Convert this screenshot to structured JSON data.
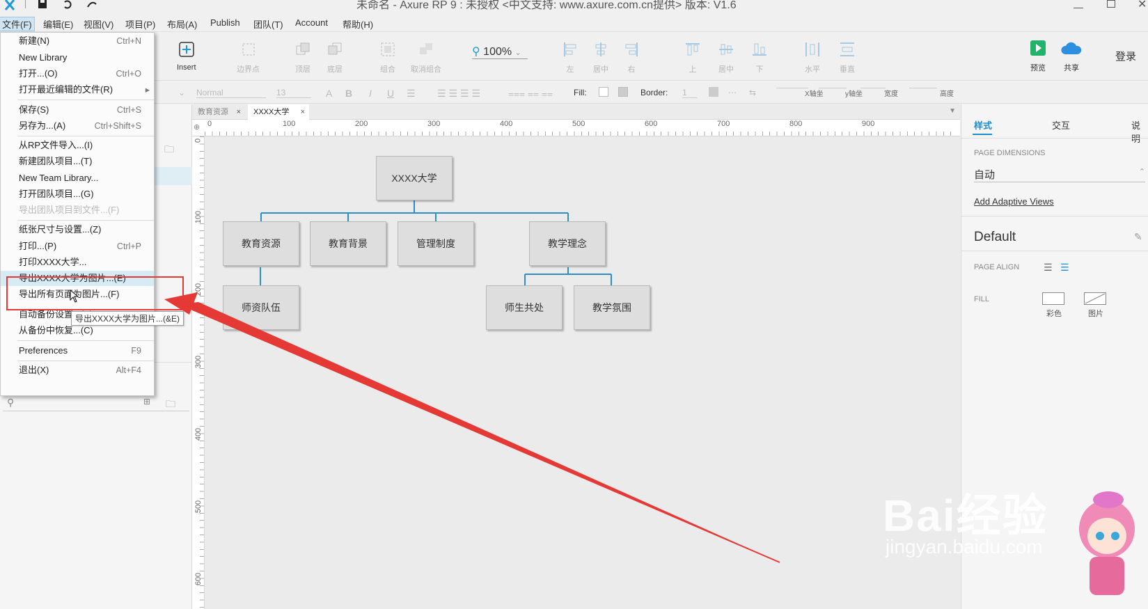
{
  "window": {
    "title": "未命名 - Axure RP 9 : 未授权   <中文支持: www.axure.com.cn提供> 版本: V1.6"
  },
  "menubar": [
    "文件(F)",
    "编辑(E)",
    "视图(V)",
    "项目(P)",
    "布局(A)",
    "Publish",
    "团队(T)",
    "Account",
    "帮助(H)"
  ],
  "toolbar": {
    "insert": "Insert",
    "boundary": "边界点",
    "top_layer": "顶层",
    "bottom_layer": "底层",
    "group": "组合",
    "ungroup": "取消组合",
    "zoom": "100%",
    "align_left": "左",
    "align_center": "居中",
    "align_right": "右",
    "align_top": "上",
    "align_middle": "居中",
    "align_bottom": "下",
    "dist_h": "水平",
    "dist_v": "垂直",
    "preview": "预览",
    "share": "共享",
    "login": "登录"
  },
  "formatbar": {
    "style": "Normal",
    "size": "13",
    "fill": "Fill:",
    "border": "Border:",
    "border_val": "1",
    "x": "X轴坐",
    "y": "y轴坐",
    "w": "宽度",
    "h": "高度"
  },
  "tabs": [
    "教育资源",
    "XXXX大学"
  ],
  "ruler_h": [
    "0",
    "100",
    "200",
    "300",
    "400",
    "500",
    "600",
    "700",
    "800",
    "900"
  ],
  "ruler_v": [
    "0",
    "100",
    "200",
    "300",
    "400",
    "500",
    "600"
  ],
  "diagram": {
    "root": "XXXX大学",
    "level1": [
      "教育资源",
      "教育背景",
      "管理制度",
      "教学理念"
    ],
    "child_resource": "师资队伍",
    "children_concept": [
      "师生共处",
      "教学氛围"
    ]
  },
  "rightpanel": {
    "tabs": [
      "样式",
      "交互",
      "说明"
    ],
    "page_dimensions_label": "PAGE DIMENSIONS",
    "page_dimensions_value": "自动",
    "adaptive_link": "Add Adaptive Views",
    "default": "Default",
    "page_align": "PAGE ALIGN",
    "fill": "FILL",
    "fill_color": "彩色",
    "fill_image": "图片"
  },
  "file_menu": [
    {
      "label": "新建(N)",
      "shortcut": "Ctrl+N"
    },
    {
      "label": "New Library",
      "shortcut": ""
    },
    {
      "label": "打开...(O)",
      "shortcut": "Ctrl+O"
    },
    {
      "label": "打开最近编辑的文件(R)",
      "shortcut": "▸"
    },
    {
      "label": "保存(S)",
      "shortcut": "Ctrl+S"
    },
    {
      "label": "另存为...(A)",
      "shortcut": "Ctrl+Shift+S"
    },
    {
      "label": "从RP文件导入...(I)",
      "shortcut": ""
    },
    {
      "label": "新建团队项目...(T)",
      "shortcut": ""
    },
    {
      "label": "New Team Library...",
      "shortcut": ""
    },
    {
      "label": "打开团队项目...(G)",
      "shortcut": ""
    },
    {
      "label": "导出团队项目到文件...(F)",
      "shortcut": ""
    },
    {
      "label": "纸张尺寸与设置...(Z)",
      "shortcut": ""
    },
    {
      "label": "打印...(P)",
      "shortcut": "Ctrl+P"
    },
    {
      "label": "打印XXXX大学...",
      "shortcut": ""
    },
    {
      "label": "导出XXXX大学为图片...(E)",
      "shortcut": ""
    },
    {
      "label": "导出所有页面为图片...(F)",
      "shortcut": ""
    },
    {
      "label": "自动备份设置...(B)",
      "shortcut": ""
    },
    {
      "label": "从备份中恢复...(C)",
      "shortcut": ""
    },
    {
      "label": "Preferences",
      "shortcut": "F9"
    },
    {
      "label": "退出(X)",
      "shortcut": "Alt+F4"
    }
  ],
  "tooltip": "导出XXXX大学为图片...(&E)",
  "watermark": {
    "brand": "Bai经验",
    "url": "jingyan.baidu.com"
  }
}
